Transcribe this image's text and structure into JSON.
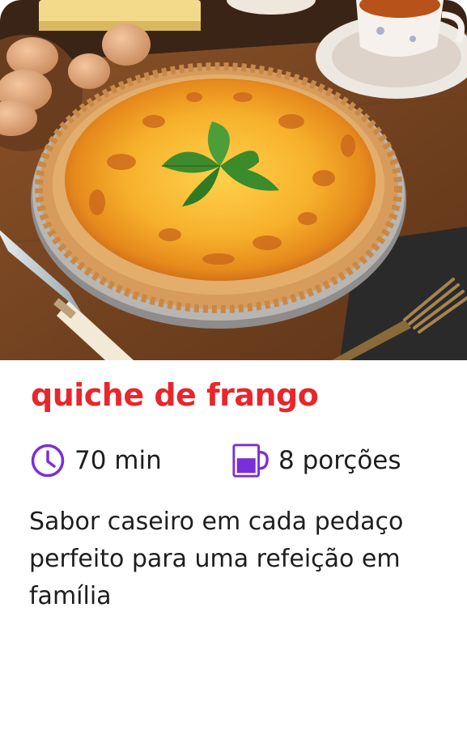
{
  "recipe": {
    "title": "quiche de frango",
    "time": "70 min",
    "servings": "8 porções",
    "description": "Sabor caseiro em cada pedaço perfeito para uma refeição em família"
  },
  "icons": {
    "time": "clock-icon",
    "servings": "mug-icon"
  },
  "colors": {
    "title": "#e8262b",
    "accent": "#7a2fd6",
    "text": "#1e1e1e"
  }
}
